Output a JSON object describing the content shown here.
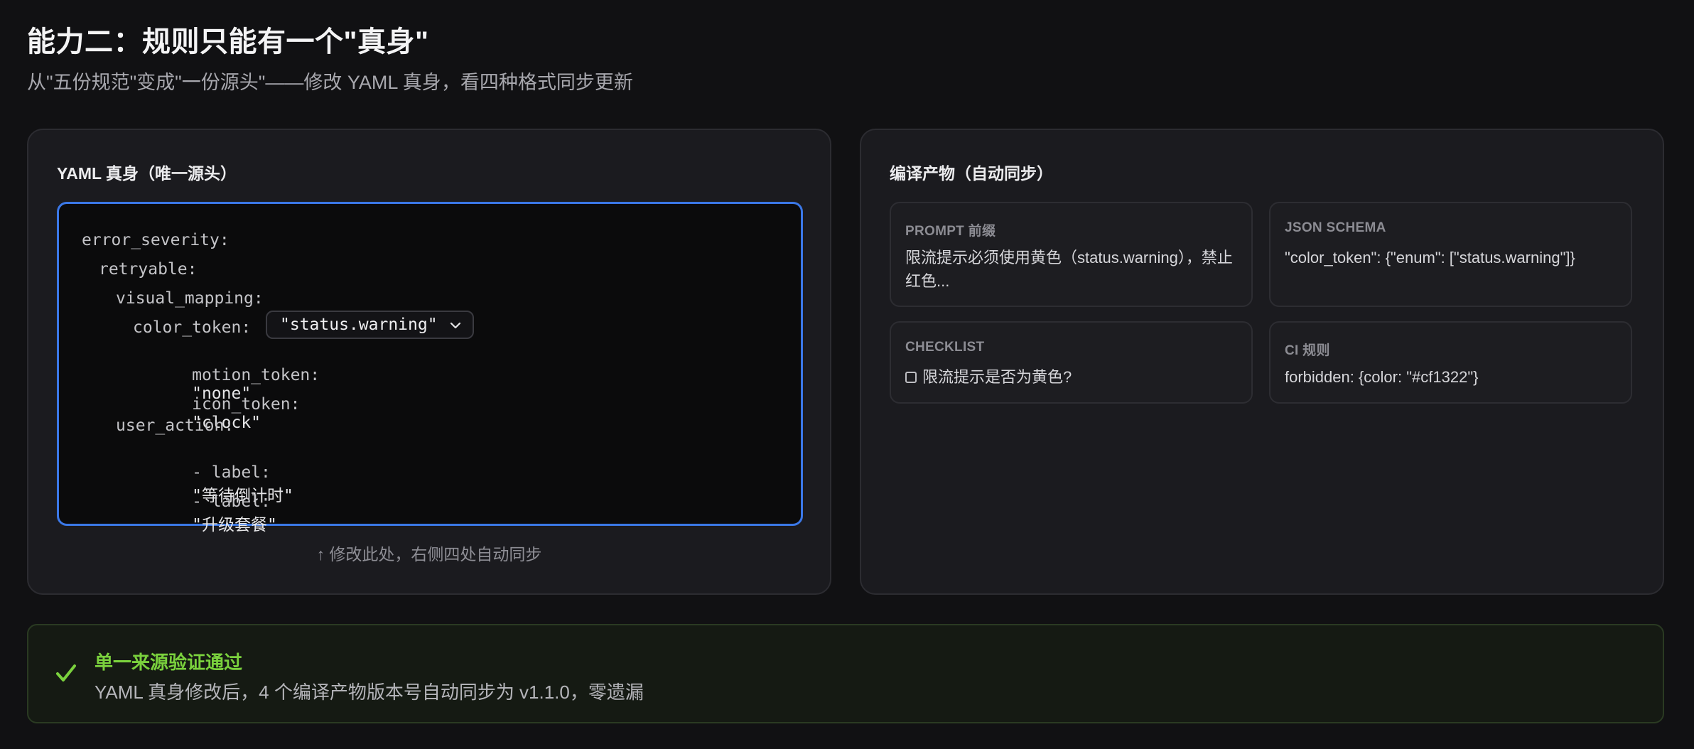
{
  "header": {
    "title": "能力二：规则只能有一个\"真身\"",
    "subtitle": "从\"五份规范\"变成\"一份源头\"——修改 YAML 真身，看四种格式同步更新"
  },
  "source_panel": {
    "title": "YAML 真身（唯一源头）",
    "yaml": {
      "root_key": "error_severity:",
      "retryable_key": "retryable:",
      "visual_mapping_key": "visual_mapping:",
      "color_token_key": "color_token:",
      "color_token_value": "\"status.warning\"",
      "motion_token_key": "motion_token:",
      "motion_token_value": "\"none\"",
      "icon_token_key": "icon_token:",
      "icon_token_value": "\"clock\"",
      "user_action_key": "user_action:",
      "action_prefix": "- label:",
      "action_1": "\"等待倒计时\"",
      "action_2": "\"升级套餐\""
    },
    "hint": "↑ 修改此处，右侧四处自动同步"
  },
  "output_panel": {
    "title": "编译产物（自动同步）",
    "cards": [
      {
        "label": "PROMPT 前缀",
        "value": "限流提示必须使用黄色（status.warning），禁止红色..."
      },
      {
        "label": "JSON SCHEMA",
        "value": "\"color_token\": {\"enum\": [\"status.warning\"]}"
      },
      {
        "label": "CHECKLIST",
        "value": "限流提示是否为黄色?"
      },
      {
        "label": "CI 规则",
        "value": "forbidden: {color: \"#cf1322\"}"
      }
    ]
  },
  "status": {
    "title": "单一来源验证通过",
    "description": "YAML 真身修改后，4 个编译产物版本号自动同步为 v1.1.0，零遗漏"
  },
  "colors": {
    "accent_border": "#3b78e7",
    "success": "#7ad13d",
    "background": "#111113"
  },
  "icons": {
    "dropdown": "chevron-down-icon",
    "checkbox": "checkbox-icon",
    "success": "check-icon"
  }
}
